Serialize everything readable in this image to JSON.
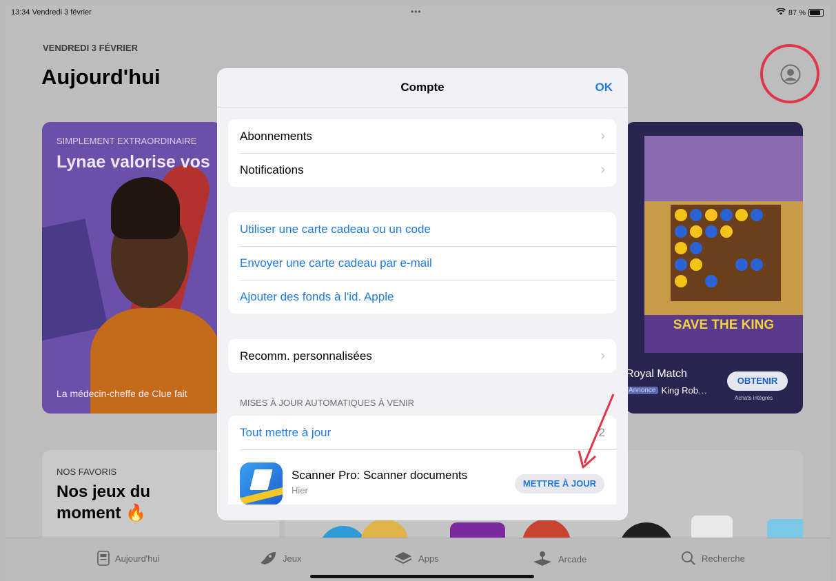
{
  "status_bar": {
    "time_date": "13:34  Vendredi 3 février",
    "center_dots": "•••",
    "battery": "87 %"
  },
  "today": {
    "date_caps": "VENDREDI 3 FÉVRIER",
    "title": "Aujourd'hui"
  },
  "cards": {
    "left": {
      "eyebrow": "SIMPLEMENT EXTRAORDINAIRE",
      "headline": "Lynae valorise vos",
      "caption": "La médecin-cheffe de Clue fait"
    },
    "right": {
      "save_text": "SAVE THE KING",
      "app_name": "Royal Match",
      "ad_badge": "Annonce",
      "developer": "King Rob…",
      "get_label": "OBTENIR",
      "iap_note": "Achats intégrés"
    },
    "bottom": {
      "eyebrow": "NOS FAVORIS",
      "title": "Nos jeux du moment 🔥"
    }
  },
  "modal": {
    "title": "Compte",
    "ok_label": "OK",
    "group1": [
      "Abonnements",
      "Notifications"
    ],
    "group2": [
      "Utiliser une carte cadeau ou un code",
      "Envoyer une carte cadeau par e-mail",
      "Ajouter des fonds à l'id. Apple"
    ],
    "group3": [
      "Recomm. personnalisées"
    ],
    "section_header": "MISES À JOUR AUTOMATIQUES À VENIR",
    "update_all_label": "Tout mettre à jour",
    "update_count": "2",
    "app": {
      "name": "Scanner Pro: Scanner documents",
      "date": "Hier",
      "update_label": "METTRE À JOUR"
    }
  },
  "tabbar": {
    "items": [
      "Aujourd'hui",
      "Jeux",
      "Apps",
      "Arcade",
      "Recherche"
    ]
  },
  "colors": {
    "accent": "#1f7ae0",
    "annotation_red": "#e0364c"
  }
}
